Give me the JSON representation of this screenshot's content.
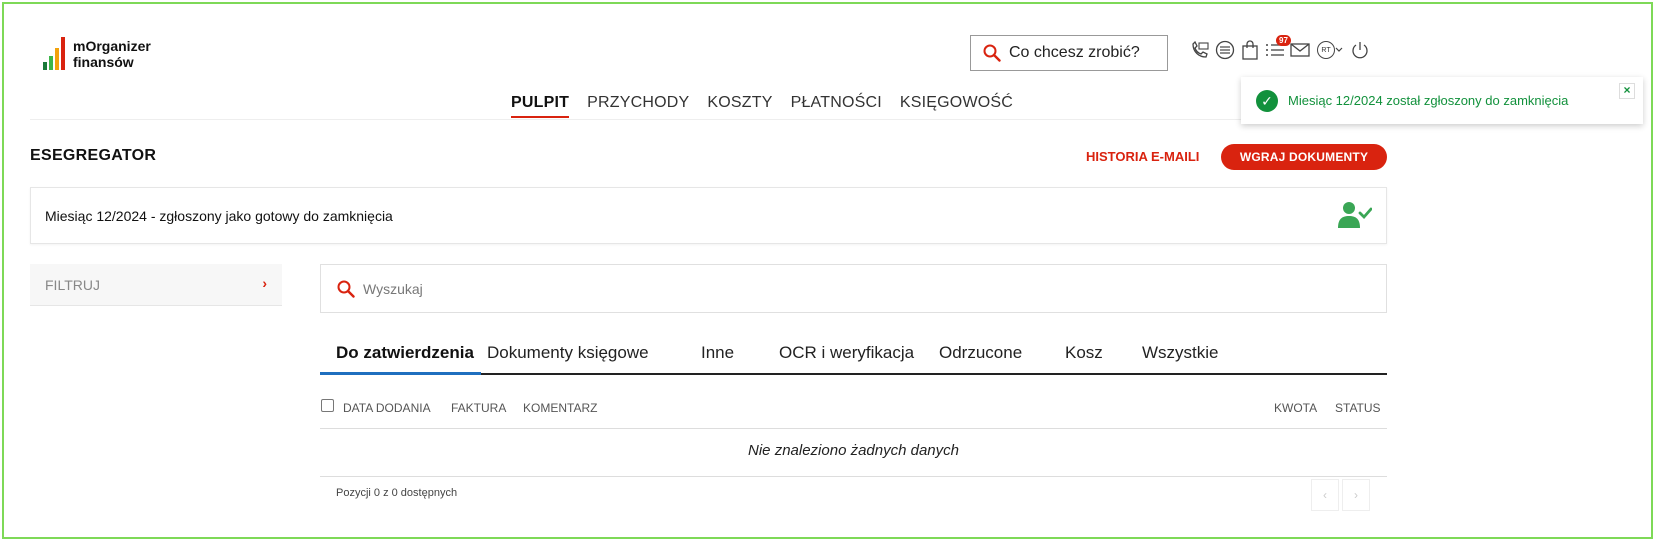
{
  "header": {
    "logo_line1": "mOrganizer",
    "logo_line2": "finansów",
    "search_label": "Co chcesz zrobić?",
    "notifications_badge": "97",
    "avatar_initials": "RT",
    "logo_colors": [
      "#1a7a3a",
      "#3db64a",
      "#f2a20c",
      "#d9230f"
    ]
  },
  "nav": {
    "items": [
      {
        "label": "PULPIT",
        "active": true
      },
      {
        "label": "PRZYCHODY",
        "active": false
      },
      {
        "label": "KOSZTY",
        "active": false
      },
      {
        "label": "PŁATNOŚCI",
        "active": false
      },
      {
        "label": "KSIĘGOWOŚĆ",
        "active": false
      }
    ]
  },
  "toast": {
    "message": "Miesiąc 12/2024 został zgłoszony do zamknięcia",
    "close": "×",
    "color": "#12913c"
  },
  "section": {
    "title": "ESEGREGATOR",
    "history_link": "HISTORIA E-MAILI",
    "upload_button": "WGRAJ DOKUMENTY",
    "status_text": "Miesiąc 12/2024 - zgłoszony jako gotowy do zamknięcia"
  },
  "filter": {
    "label": "FILTRUJ",
    "arrow": "›"
  },
  "search": {
    "placeholder": "Wyszukaj"
  },
  "tabs": [
    {
      "label": "Do zatwierdzenia",
      "active": true
    },
    {
      "label": "Dokumenty księgowe",
      "active": false
    },
    {
      "label": "Inne",
      "active": false
    },
    {
      "label": "OCR i weryfikacja",
      "active": false
    },
    {
      "label": "Odrzucone",
      "active": false
    },
    {
      "label": "Kosz",
      "active": false
    },
    {
      "label": "Wszystkie",
      "active": false
    }
  ],
  "table": {
    "columns": [
      "DATA DODANIA",
      "FAKTURA",
      "KOMENTARZ",
      "KWOTA",
      "STATUS"
    ],
    "empty_message": "Nie znaleziono żadnych danych",
    "footer_info": "Pozycji 0 z 0 dostępnych",
    "prev": "‹",
    "next": "›"
  },
  "colors": {
    "accent": "#d9230f",
    "success": "#12913c",
    "tab_active": "#1f6fbf"
  }
}
